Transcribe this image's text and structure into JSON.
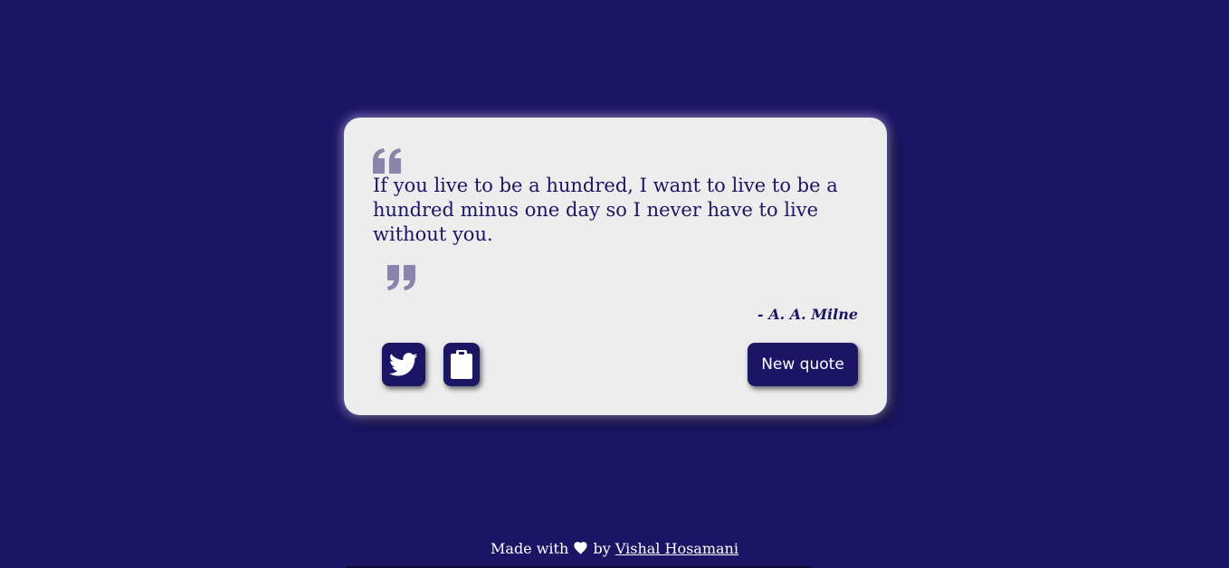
{
  "quote": {
    "text": "If you live to be a hundred, I want to live to be a hundred minus one day so I never have to live without you.",
    "author": "- A. A. Milne",
    "open_icon": "open-quote-icon",
    "close_icon": "close-quote-icon"
  },
  "actions": {
    "tweet_icon": "twitter-icon",
    "copy_icon": "clipboard-icon",
    "new_quote_label": "New quote"
  },
  "footer": {
    "made_with": "Made with",
    "heart_icon": "heart-icon",
    "by": "by",
    "author_link": "Vishal Hosamani"
  },
  "colors": {
    "background": "#1c1565",
    "card": "#ededed",
    "quote_mark": "#8a85ab",
    "text": "#1c1565"
  }
}
